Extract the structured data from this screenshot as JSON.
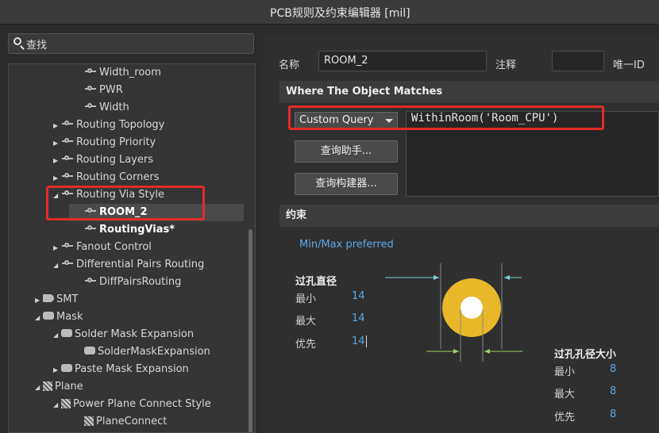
{
  "window": {
    "title": "PCB规则及约束编辑器 [mil]"
  },
  "search": {
    "label": "查找"
  },
  "tree": {
    "items": [
      {
        "label": "Width_room",
        "icon": "route-rule-icon"
      },
      {
        "label": "PWR",
        "icon": "route-rule-icon"
      },
      {
        "label": "Width",
        "icon": "route-rule-icon"
      },
      {
        "label": "Routing Topology",
        "icon": "route-category-icon"
      },
      {
        "label": "Routing Priority",
        "icon": "route-category-icon"
      },
      {
        "label": "Routing Layers",
        "icon": "route-category-icon"
      },
      {
        "label": "Routing Corners",
        "icon": "route-category-icon"
      },
      {
        "label": "Routing Via Style",
        "icon": "route-category-icon"
      },
      {
        "label": "ROOM_2",
        "icon": "route-rule-icon"
      },
      {
        "label": "RoutingVias*",
        "icon": "route-rule-icon"
      },
      {
        "label": "Fanout Control",
        "icon": "route-category-icon"
      },
      {
        "label": "Differential Pairs Routing",
        "icon": "route-category-icon"
      },
      {
        "label": "DiffPairsRouting",
        "icon": "route-rule-icon"
      },
      {
        "label": "SMT",
        "icon": "smt-icon"
      },
      {
        "label": "Mask",
        "icon": "mask-icon"
      },
      {
        "label": "Solder Mask Expansion",
        "icon": "mask-icon"
      },
      {
        "label": "SolderMaskExpansion",
        "icon": "mask-icon"
      },
      {
        "label": "Paste Mask Expansion",
        "icon": "mask-icon"
      },
      {
        "label": "Plane",
        "icon": "plane-icon"
      },
      {
        "label": "Power Plane Connect Style",
        "icon": "plane-icon"
      },
      {
        "label": "PlaneConnect",
        "icon": "plane-icon"
      }
    ]
  },
  "rule": {
    "name_label": "名称",
    "name_value": "ROOM_2",
    "comment_label": "注释",
    "comment_value": "",
    "uid_label": "唯一ID"
  },
  "where": {
    "header": "Where The Object Matches",
    "scope_selected": "Custom Query",
    "query_helper_button": "查询助手... ",
    "query_builder_button": "查询构建器... ",
    "query_text": "WithinRoom('Room_CPU')"
  },
  "constraints": {
    "header": "约束",
    "mode": "Min/Max preferred",
    "via_diameter": {
      "title": "过孔直径",
      "min_label": "最小",
      "min": "14",
      "max_label": "最大",
      "max": "14",
      "pref_label": "优先",
      "pref": "14"
    },
    "hole_size": {
      "title": "过孔孔径大小",
      "min_label": "最小",
      "min": "8",
      "max_label": "最大",
      "max": "8",
      "pref_label": "优先",
      "pref": "8"
    }
  },
  "colors": {
    "highlight_box": "#e52a2a",
    "value_text": "#5aa7e6",
    "via_copper": "#e8b82a"
  }
}
